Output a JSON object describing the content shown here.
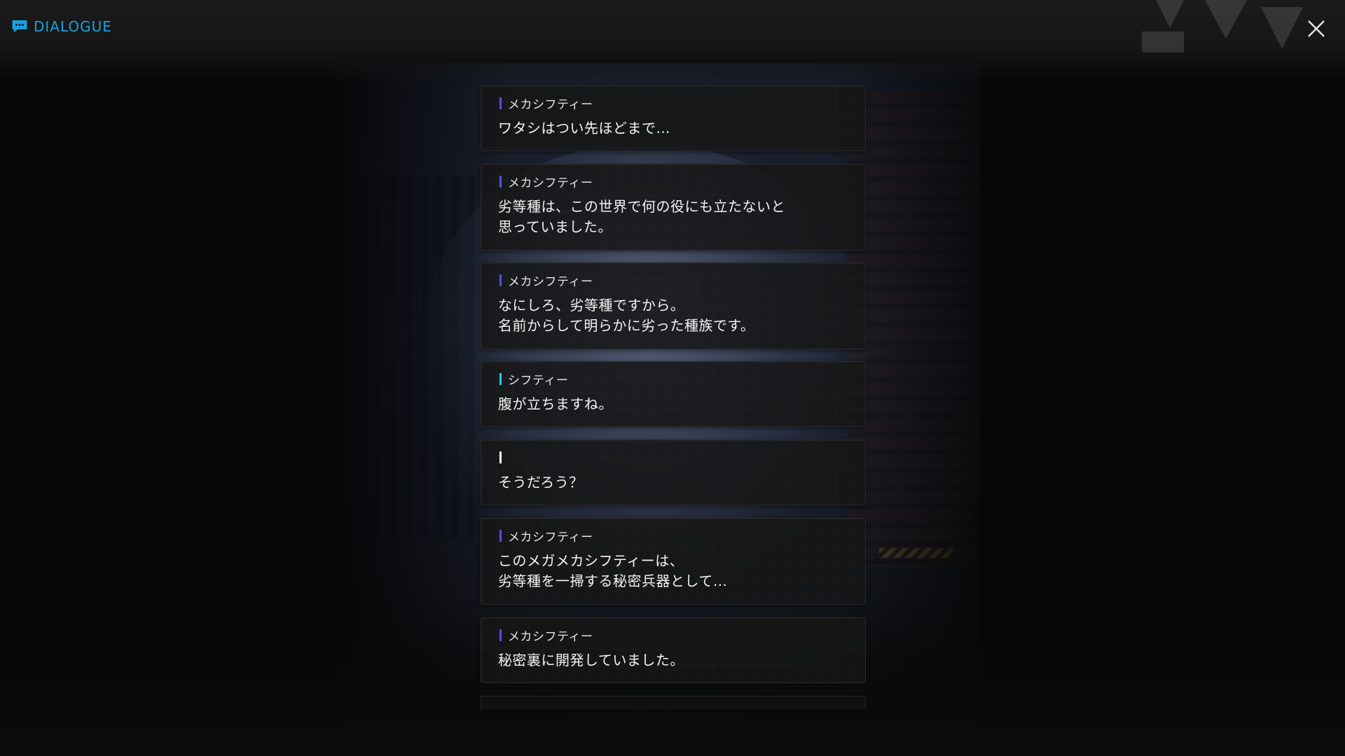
{
  "header": {
    "title": "DIALOGUE",
    "title_icon": "chat-bubble-icon",
    "close_icon": "close-icon"
  },
  "colors": {
    "accent_blue": "#1aa0e0",
    "speaker_purple": "#5a4ee6",
    "speaker_cyan": "#2ec7e8",
    "speaker_white": "#ffffff"
  },
  "dialogue": [
    {
      "speaker": "メカシフティー",
      "marker": "purple",
      "text": "ワタシはつい先ほどまで…"
    },
    {
      "speaker": "メカシフティー",
      "marker": "purple",
      "text": "劣等種は、この世界で何の役にも立たないと\n思っていました。"
    },
    {
      "speaker": "メカシフティー",
      "marker": "purple",
      "text": "なにしろ、劣等種ですから。\n名前からして明らかに劣った種族です。"
    },
    {
      "speaker": "シフティー",
      "marker": "cyan",
      "text": "腹が立ちますね。"
    },
    {
      "speaker": "",
      "marker": "white",
      "text": "そうだろう？"
    },
    {
      "speaker": "メカシフティー",
      "marker": "purple",
      "text": "このメガメカシフティーは、\n劣等種を一掃する秘密兵器として…"
    },
    {
      "speaker": "メカシフティー",
      "marker": "purple",
      "text": "秘密裏に開発していました。"
    }
  ]
}
